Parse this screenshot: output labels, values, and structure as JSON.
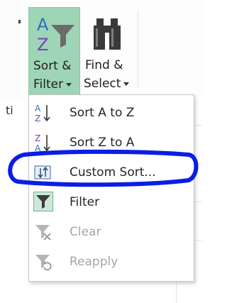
{
  "ribbon": {
    "sort_filter": {
      "line1": "Sort &",
      "line2": "Filter",
      "icon": "sort-az-filter-icon"
    },
    "find_select": {
      "line1": "Find &",
      "line2": "Select",
      "icon": "binoculars-icon"
    }
  },
  "sheet": {
    "partial_cell_text": "ti"
  },
  "menu": {
    "items": [
      {
        "label": "Sort A to Z",
        "icon": "sort-a-to-z-icon",
        "enabled": true
      },
      {
        "label": "Sort Z to A",
        "icon": "sort-z-to-a-icon",
        "enabled": true
      },
      {
        "label": "Custom Sort...",
        "icon": "custom-sort-icon",
        "enabled": true,
        "annotated": true
      },
      {
        "label": "Filter",
        "icon": "filter-icon",
        "enabled": true,
        "toggled": true
      },
      {
        "label": "Clear",
        "icon": "clear-filter-icon",
        "enabled": false
      },
      {
        "label": "Reapply",
        "icon": "reapply-filter-icon",
        "enabled": false
      }
    ]
  },
  "colors": {
    "accent_green": "#9fd5b7",
    "annotation_blue": "#0a1ee6",
    "sort_purple": "#7b3fb5",
    "sort_blue": "#2f6fb8"
  }
}
